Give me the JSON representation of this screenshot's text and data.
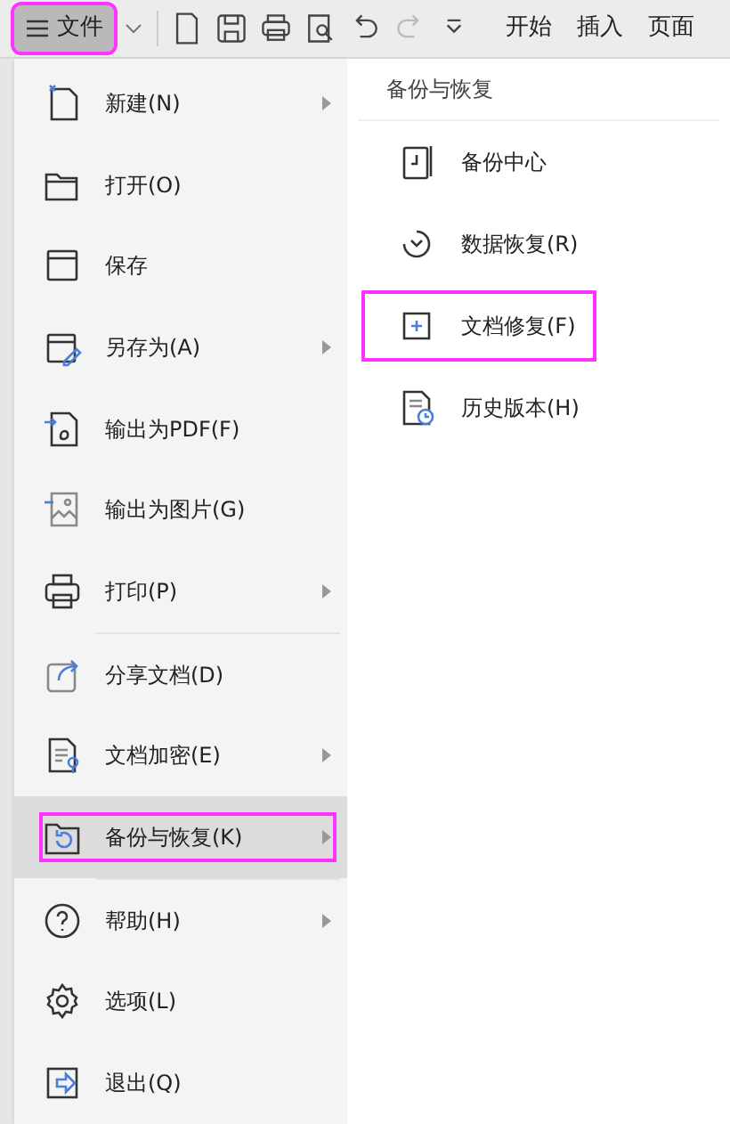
{
  "toolbar": {
    "file_button": {
      "label": "文件",
      "annotated": true
    },
    "tabs": [
      {
        "label": "开始"
      },
      {
        "label": "插入"
      },
      {
        "label": "页面"
      }
    ]
  },
  "menu": {
    "items": [
      {
        "label": "新建(N)",
        "submenu": true,
        "selected": false,
        "annotated": false,
        "divider_before": false
      },
      {
        "label": "打开(O)",
        "submenu": false,
        "selected": false,
        "annotated": false,
        "divider_before": false
      },
      {
        "label": "保存",
        "submenu": false,
        "selected": false,
        "annotated": false,
        "divider_before": false
      },
      {
        "label": "另存为(A)",
        "submenu": true,
        "selected": false,
        "annotated": false,
        "divider_before": false
      },
      {
        "label": "输出为PDF(F)",
        "submenu": false,
        "selected": false,
        "annotated": false,
        "divider_before": false
      },
      {
        "label": "输出为图片(G)",
        "submenu": false,
        "selected": false,
        "annotated": false,
        "divider_before": false
      },
      {
        "label": "打印(P)",
        "submenu": true,
        "selected": false,
        "annotated": false,
        "divider_before": false
      },
      {
        "label": "分享文档(D)",
        "submenu": false,
        "selected": false,
        "annotated": false,
        "divider_before": true
      },
      {
        "label": "文档加密(E)",
        "submenu": true,
        "selected": false,
        "annotated": false,
        "divider_before": false
      },
      {
        "label": "备份与恢复(K)",
        "submenu": true,
        "selected": true,
        "annotated": true,
        "divider_before": false
      },
      {
        "label": "帮助(H)",
        "submenu": true,
        "selected": false,
        "annotated": false,
        "divider_before": true
      },
      {
        "label": "选项(L)",
        "submenu": false,
        "selected": false,
        "annotated": false,
        "divider_before": false
      },
      {
        "label": "退出(Q)",
        "submenu": false,
        "selected": false,
        "annotated": false,
        "divider_before": false
      }
    ]
  },
  "submenu": {
    "title": "备份与恢复",
    "items": [
      {
        "label": "备份中心",
        "annotated": false
      },
      {
        "label": "数据恢复(R)",
        "annotated": false
      },
      {
        "label": "文档修复(F)",
        "annotated": true
      },
      {
        "label": "历史版本(H)",
        "annotated": false
      }
    ]
  }
}
